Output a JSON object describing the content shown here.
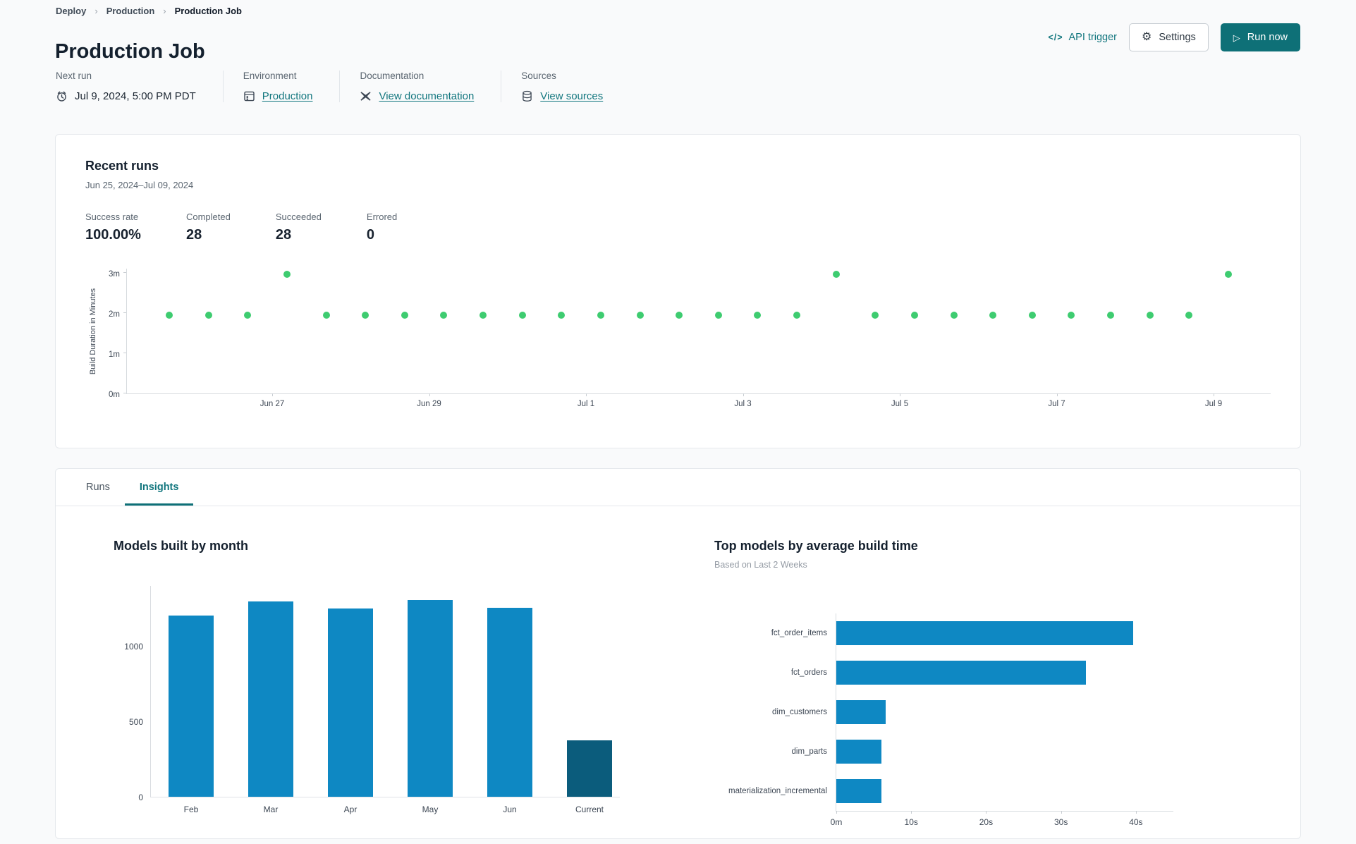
{
  "breadcrumb": {
    "items": [
      "Deploy",
      "Production",
      "Production Job"
    ],
    "separator": "›"
  },
  "header": {
    "title": "Production Job",
    "api_trigger_label": "API trigger",
    "api_trigger_icon": "</>",
    "settings_label": "Settings",
    "settings_icon": "⚙",
    "run_now_label": "Run now",
    "run_now_icon": "▷"
  },
  "meta": {
    "next_run": {
      "label": "Next run",
      "value": "Jul 9, 2024, 5:00 PM PDT"
    },
    "environment": {
      "label": "Environment",
      "value": "Production"
    },
    "documentation": {
      "label": "Documentation",
      "value": "View documentation"
    },
    "sources": {
      "label": "Sources",
      "value": "View sources"
    }
  },
  "recent_runs": {
    "title": "Recent runs",
    "date_range": "Jun 25, 2024–Jul 09, 2024",
    "stats": [
      {
        "label": "Success rate",
        "value": "100.00%"
      },
      {
        "label": "Completed",
        "value": "28"
      },
      {
        "label": "Succeeded",
        "value": "28"
      },
      {
        "label": "Errored",
        "value": "0"
      }
    ]
  },
  "tabs": [
    {
      "label": "Runs",
      "active": false
    },
    {
      "label": "Insights",
      "active": true
    }
  ],
  "colors": {
    "accent_teal": "#12767e",
    "button_teal": "#0e7077",
    "dot_green": "#3ecc70",
    "bar_blue": "#0e88c3",
    "bar_dark_blue": "#0b5c7c"
  },
  "chart_data": [
    {
      "name": "recent-runs-build-duration",
      "type": "scatter",
      "ylabel": "Build Duration in Minutes",
      "yticks": [
        "0m",
        "1m",
        "2m",
        "3m"
      ],
      "ylim_minutes": [
        0,
        3.12
      ],
      "x_tick_labels": [
        "Jun 27",
        "Jun 29",
        "Jul 1",
        "Jul 3",
        "Jul 5",
        "Jul 7",
        "Jul 9"
      ],
      "point_color": "#3ecc70",
      "values_minutes": [
        1.95,
        1.95,
        1.95,
        2.97,
        1.95,
        1.95,
        1.95,
        1.95,
        1.95,
        1.95,
        1.95,
        1.95,
        1.95,
        1.95,
        1.95,
        1.95,
        1.95,
        2.97,
        1.95,
        1.95,
        1.95,
        1.95,
        1.95,
        1.95,
        1.95,
        1.95,
        1.95,
        2.97
      ]
    },
    {
      "name": "models-built-by-month",
      "type": "bar",
      "title": "Models built by month",
      "categories": [
        "Feb",
        "Mar",
        "Apr",
        "May",
        "Jun",
        "Current"
      ],
      "values": [
        1200,
        1295,
        1245,
        1300,
        1250,
        375
      ],
      "yticks": [
        0,
        500,
        1000
      ],
      "ylim": [
        0,
        1400
      ],
      "bar_color": "#0e88c3",
      "current_bar_color": "#0b5c7c",
      "grid": false,
      "legend": "none"
    },
    {
      "name": "top-models-by-avg-build-time",
      "type": "bar-horizontal",
      "title": "Top models by average build time",
      "subtitle": "Based on Last 2 Weeks",
      "categories": [
        "fct_order_items",
        "fct_orders",
        "dim_customers",
        "dim_parts",
        "materialization_incremental"
      ],
      "values_seconds": [
        39.6,
        33.3,
        6.6,
        6.0,
        6.0
      ],
      "x_tick_labels": [
        "0m",
        "10s",
        "20s",
        "30s",
        "40s"
      ],
      "x_tick_values": [
        0,
        10,
        20,
        30,
        40
      ],
      "xlim": [
        0,
        45
      ],
      "bar_color": "#0e88c3",
      "grid": false,
      "legend": "none"
    }
  ]
}
